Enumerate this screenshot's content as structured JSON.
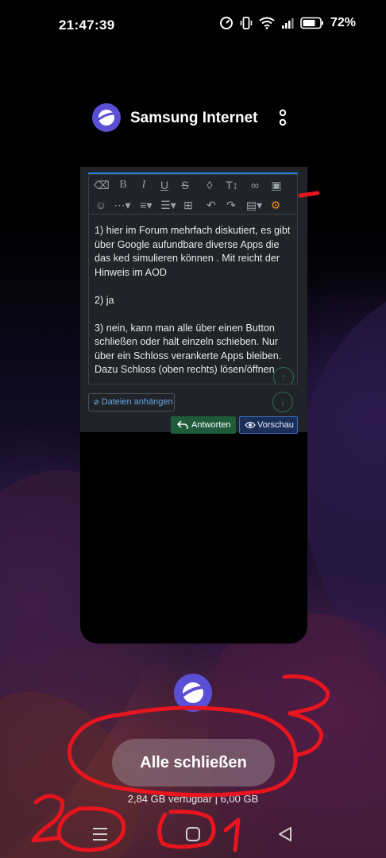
{
  "status_bar": {
    "time": "21:47:39",
    "battery_percent": "72%",
    "icons": [
      "speedometer-icon",
      "vibrate-icon",
      "wifi-icon",
      "signal-icon",
      "battery-icon"
    ]
  },
  "app": {
    "name": "Samsung Internet",
    "icon": "samsung-internet-icon",
    "menu_icon": "more-vertical-icon"
  },
  "editor": {
    "paragraphs": [
      "1) hier im Forum mehrfach diskutiert, es gibt über Google aufundbare diverse Apps die das ked simulieren können . Mit reicht der Hinweis im AOD",
      "2) ja",
      "3) nein, kann man alle über einen Button schließen oder halt einzeln schieben. Nur über ein Schloss verankerte Apps bleiben. Dazu Schloss (oben rechts) lösen/öffnen"
    ],
    "toolbar_row1": [
      "eraser-icon",
      "bold-icon",
      "italic-icon",
      "underline-icon",
      "strikethrough-icon",
      "color-drop-icon",
      "text-size-icon",
      "link-icon",
      "image-icon"
    ],
    "toolbar_row2": [
      "emoji-icon",
      "more-dropdown-icon",
      "align-dropdown-icon",
      "list-dropdown-icon",
      "table-icon",
      "undo-icon",
      "redo-icon",
      "save-dropdown-icon",
      "settings-gear-icon"
    ],
    "attach_label": "Dateien anhängen",
    "reply_label": "Antworten",
    "preview_label": "Vorschau"
  },
  "recents": {
    "close_all_label": "Alle schließen",
    "memory_text": "2,84 GB verfügbar | 6,00 GB"
  },
  "nav": [
    "recents-menu-icon",
    "home-icon",
    "back-icon"
  ],
  "colors": {
    "annotation_red": "#e8141e",
    "toolbar_accent": "#2b79c9",
    "reply_green": "#1f5a3b",
    "preview_blue": "#1a2e57",
    "gear_orange": "#e8901c"
  }
}
